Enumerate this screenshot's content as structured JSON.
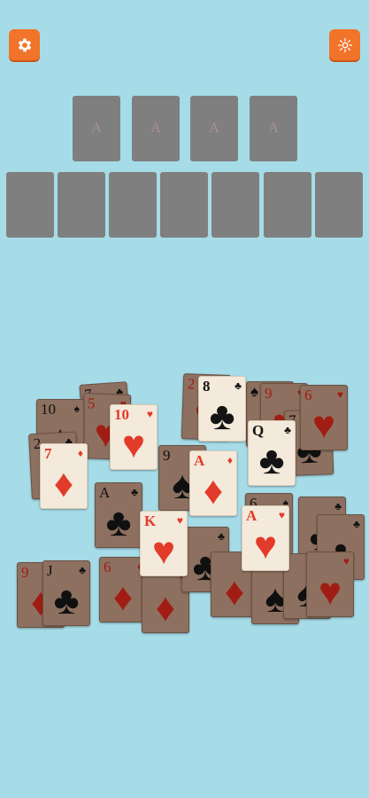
{
  "toolbar": {
    "settings_left_icon": "gear-icon",
    "settings_right_icon": "gear-outline-icon"
  },
  "foundations": [
    {
      "label": "A"
    },
    {
      "label": "A"
    },
    {
      "label": "A"
    },
    {
      "label": "A"
    }
  ],
  "tableau_slots": 7,
  "colors": {
    "background": "#a6dce8",
    "button": "#f2742a",
    "slot": "#7f7f7f",
    "card_face": "#f4eadb",
    "card_back": "#8d7060",
    "red_suit": "#e23b2a",
    "black_suit": "#141414"
  },
  "cards": [
    {
      "id": "c1",
      "rank": "7",
      "suit": "♣",
      "color": "black",
      "face": "down"
    },
    {
      "id": "c2",
      "rank": "5",
      "suit": "♥",
      "color": "red",
      "face": "down"
    },
    {
      "id": "c3",
      "rank": "10",
      "suit": "♠",
      "color": "black",
      "face": "down"
    },
    {
      "id": "c4",
      "rank": "2",
      "suit": "♥",
      "color": "red",
      "face": "down"
    },
    {
      "id": "c5",
      "rank": "♠",
      "suit": "♠",
      "color": "black",
      "face": "down"
    },
    {
      "id": "c6",
      "rank": "9",
      "suit": "♥",
      "color": "red",
      "face": "down"
    },
    {
      "id": "c7",
      "rank": "7",
      "suit": "♣",
      "color": "black",
      "face": "down"
    },
    {
      "id": "c8",
      "rank": "2",
      "suit": "♣",
      "color": "black",
      "face": "down"
    },
    {
      "id": "c9",
      "rank": "9",
      "suit": "♠",
      "color": "black",
      "face": "down"
    },
    {
      "id": "c10",
      "rank": "A",
      "suit": "♣",
      "color": "black",
      "face": "down"
    },
    {
      "id": "c11",
      "rank": "6",
      "suit": "♠",
      "color": "black",
      "face": "down"
    },
    {
      "id": "c12",
      "rank": "6",
      "suit": "♥",
      "color": "red",
      "face": "down"
    },
    {
      "id": "c13",
      "rank": "",
      "suit": "♣",
      "color": "black",
      "face": "down"
    },
    {
      "id": "c14",
      "rank": "",
      "suit": "♣",
      "color": "black",
      "face": "down"
    },
    {
      "id": "c15",
      "rank": "9",
      "suit": "♦",
      "color": "red",
      "face": "down"
    },
    {
      "id": "c16",
      "rank": "J",
      "suit": "♣",
      "color": "black",
      "face": "down"
    },
    {
      "id": "c17",
      "rank": "6",
      "suit": "♦",
      "color": "red",
      "face": "down"
    },
    {
      "id": "c18",
      "rank": "",
      "suit": "♦",
      "color": "red",
      "face": "down"
    },
    {
      "id": "c19",
      "rank": "",
      "suit": "♣",
      "color": "black",
      "face": "down"
    },
    {
      "id": "c20",
      "rank": "",
      "suit": "♦",
      "color": "red",
      "face": "down"
    },
    {
      "id": "c21",
      "rank": "",
      "suit": "♠",
      "color": "black",
      "face": "down"
    },
    {
      "id": "c22",
      "rank": "",
      "suit": "♠",
      "color": "black",
      "face": "down"
    },
    {
      "id": "c23",
      "rank": "",
      "suit": "♥",
      "color": "red",
      "face": "down"
    },
    {
      "id": "c24",
      "rank": "7",
      "suit": "♦",
      "color": "red",
      "face": "up"
    },
    {
      "id": "c25",
      "rank": "10",
      "suit": "♥",
      "color": "red",
      "face": "up"
    },
    {
      "id": "c26",
      "rank": "8",
      "suit": "♣",
      "color": "black",
      "face": "up"
    },
    {
      "id": "c27",
      "rank": "Q",
      "suit": "♣",
      "color": "black",
      "face": "up"
    },
    {
      "id": "c28",
      "rank": "A",
      "suit": "♦",
      "color": "red",
      "face": "up"
    },
    {
      "id": "c29",
      "rank": "K",
      "suit": "♥",
      "color": "red",
      "face": "up"
    },
    {
      "id": "c30",
      "rank": "A",
      "suit": "♥",
      "color": "red",
      "face": "up"
    }
  ]
}
